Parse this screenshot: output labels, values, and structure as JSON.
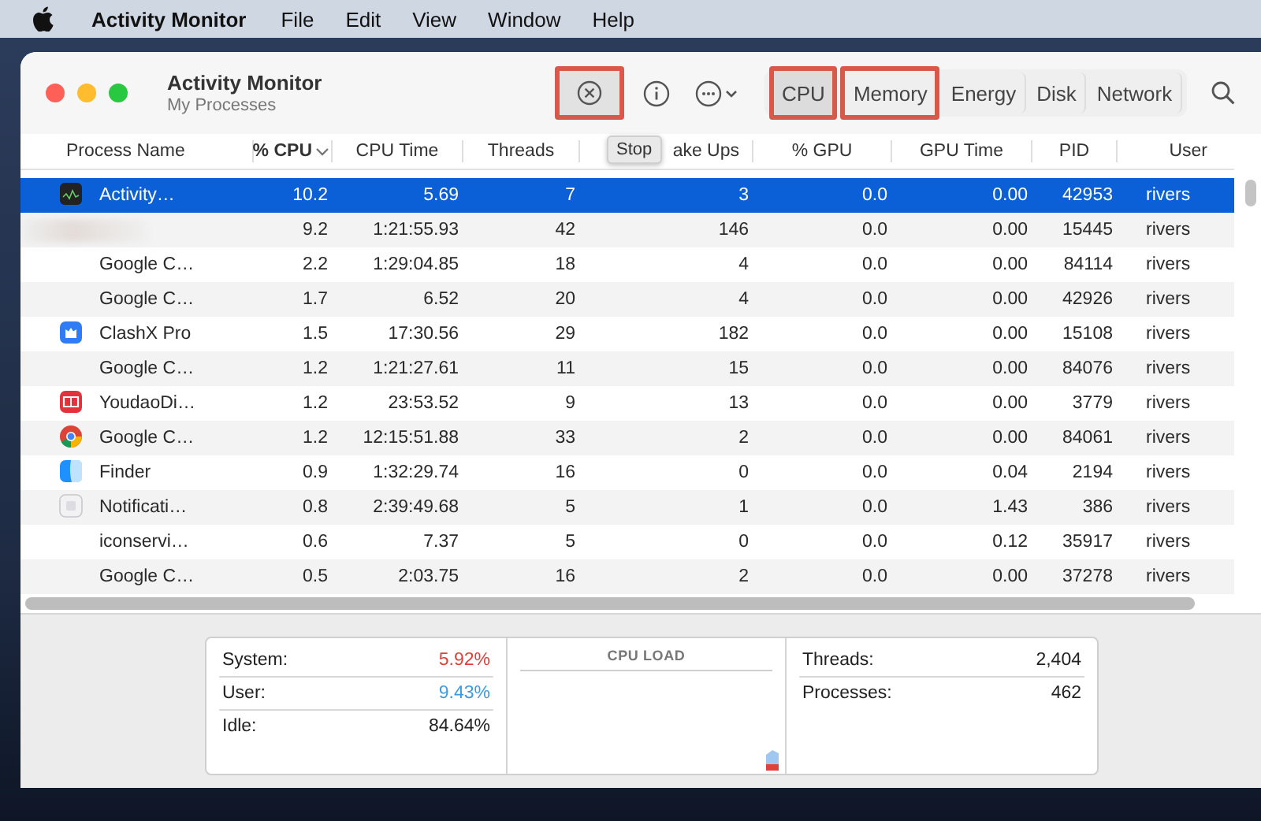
{
  "menu_bar": {
    "app_name": "Activity Monitor",
    "items": [
      "File",
      "Edit",
      "View",
      "Window",
      "Help"
    ]
  },
  "window": {
    "title": "Activity Monitor",
    "subtitle": "My Processes"
  },
  "toolbar": {
    "buttons": [
      {
        "kind": "stop",
        "highlighted": true
      },
      {
        "kind": "info",
        "highlighted": false
      },
      {
        "kind": "more",
        "highlighted": false
      }
    ],
    "tooltip": "Stop",
    "tabs": [
      {
        "label": "CPU",
        "selected": true,
        "highlighted": true
      },
      {
        "label": "Memory",
        "selected": false,
        "highlighted": true
      },
      {
        "label": "Energy",
        "selected": false,
        "highlighted": false
      },
      {
        "label": "Disk",
        "selected": false,
        "highlighted": false
      },
      {
        "label": "Network",
        "selected": false,
        "highlighted": false
      }
    ]
  },
  "table": {
    "columns": [
      {
        "label": "Process Name",
        "sorted": false
      },
      {
        "label": "% CPU",
        "sorted": true
      },
      {
        "label": "CPU Time",
        "sorted": false
      },
      {
        "label": "Threads",
        "sorted": false
      },
      {
        "label": "ake Ups",
        "sorted": false
      },
      {
        "label": "% GPU",
        "sorted": false
      },
      {
        "label": "GPU Time",
        "sorted": false
      },
      {
        "label": "PID",
        "sorted": false
      },
      {
        "label": "User",
        "sorted": false
      }
    ],
    "rows": [
      {
        "redacted": false,
        "selected": true,
        "cells": [
          "Activity…",
          "10.2",
          "5.69",
          "7",
          "3",
          "0.0",
          "0.00",
          "42953",
          "rivers"
        ]
      },
      {
        "redacted": true,
        "selected": false,
        "cells": [
          "",
          "9.2",
          "1:21:55.93",
          "42",
          "146",
          "0.0",
          "0.00",
          "15445",
          "rivers"
        ]
      },
      {
        "redacted": false,
        "selected": false,
        "cells": [
          "Google C…",
          "2.2",
          "1:29:04.85",
          "18",
          "4",
          "0.0",
          "0.00",
          "84114",
          "rivers"
        ]
      },
      {
        "redacted": false,
        "selected": false,
        "cells": [
          "Google C…",
          "1.7",
          "6.52",
          "20",
          "4",
          "0.0",
          "0.00",
          "42926",
          "rivers"
        ]
      },
      {
        "redacted": false,
        "selected": false,
        "cells": [
          "ClashX Pro",
          "1.5",
          "17:30.56",
          "29",
          "182",
          "0.0",
          "0.00",
          "15108",
          "rivers"
        ]
      },
      {
        "redacted": false,
        "selected": false,
        "cells": [
          "Google C…",
          "1.2",
          "1:21:27.61",
          "11",
          "15",
          "0.0",
          "0.00",
          "84076",
          "rivers"
        ]
      },
      {
        "redacted": false,
        "selected": false,
        "cells": [
          "YoudaoDi…",
          "1.2",
          "23:53.52",
          "9",
          "13",
          "0.0",
          "0.00",
          "3779",
          "rivers"
        ]
      },
      {
        "redacted": false,
        "selected": false,
        "cells": [
          "Google C…",
          "1.2",
          "12:15:51.88",
          "33",
          "2",
          "0.0",
          "0.00",
          "84061",
          "rivers"
        ]
      },
      {
        "redacted": false,
        "selected": false,
        "cells": [
          "Finder",
          "0.9",
          "1:32:29.74",
          "16",
          "0",
          "0.0",
          "0.04",
          "2194",
          "rivers"
        ]
      },
      {
        "redacted": false,
        "selected": false,
        "cells": [
          "Notificati…",
          "0.8",
          "2:39:49.68",
          "5",
          "1",
          "0.0",
          "1.43",
          "386",
          "rivers"
        ]
      },
      {
        "redacted": false,
        "selected": false,
        "cells": [
          "iconservi…",
          "0.6",
          "7.37",
          "5",
          "0",
          "0.0",
          "0.12",
          "35917",
          "rivers"
        ]
      },
      {
        "redacted": false,
        "selected": false,
        "cells": [
          "Google C…",
          "0.5",
          "2:03.75",
          "16",
          "2",
          "0.0",
          "0.00",
          "37278",
          "rivers"
        ]
      }
    ]
  },
  "summary": {
    "left": [
      {
        "label": "System:",
        "value": "5.92%",
        "color": "#e0403a"
      },
      {
        "label": "User:",
        "value": "9.43%",
        "color": "#3a9be0"
      },
      {
        "label": "Idle:",
        "value": "84.64%",
        "color": "#222222"
      }
    ],
    "graph_title": "CPU LOAD",
    "right": [
      {
        "label": "Threads:",
        "value": "2,404"
      },
      {
        "label": "Processes:",
        "value": "462"
      }
    ]
  }
}
